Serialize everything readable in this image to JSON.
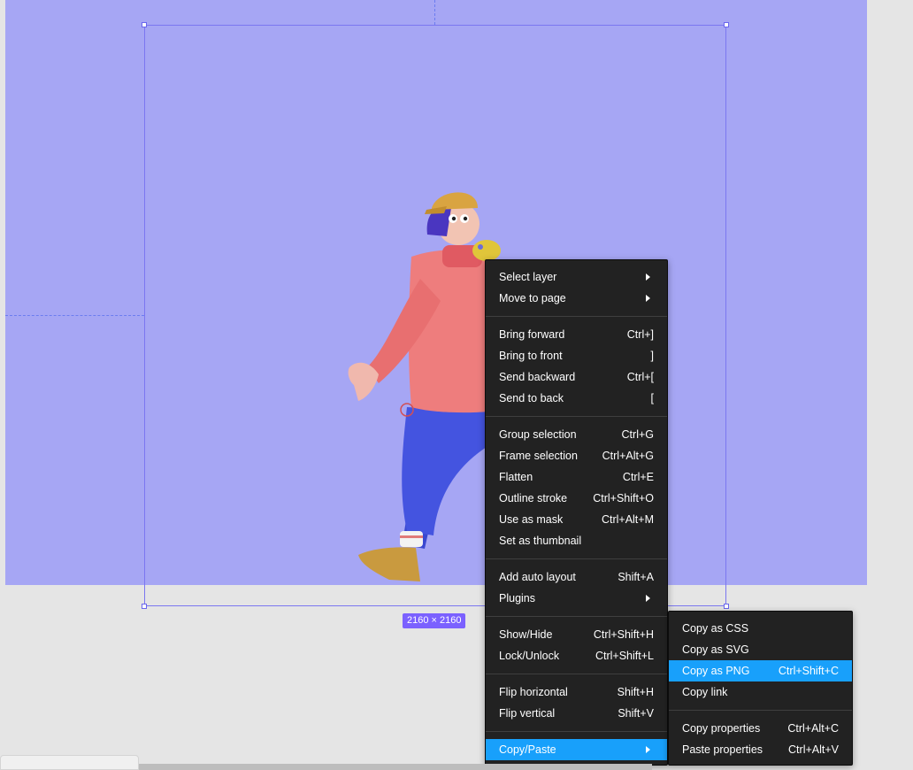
{
  "canvas": {
    "frame_color": "#a6a6f4",
    "selection_color": "#7b77f0",
    "size_label": "2160 × 2160"
  },
  "illustration": {
    "subject": "3d-character-walking-with-bird-icon",
    "colors": {
      "sweater": "#ee7d7d",
      "pants": "#4454e0",
      "cap": "#d9a441",
      "shoe": "#c99a3f",
      "hair": "#4a36c0",
      "bird": "#e0c53a"
    }
  },
  "context_menu": {
    "groups": [
      [
        {
          "label": "Select layer",
          "shortcut": "",
          "submenu": true
        },
        {
          "label": "Move to page",
          "shortcut": "",
          "submenu": true
        }
      ],
      [
        {
          "label": "Bring forward",
          "shortcut": "Ctrl+]"
        },
        {
          "label": "Bring to front",
          "shortcut": "]"
        },
        {
          "label": "Send backward",
          "shortcut": "Ctrl+["
        },
        {
          "label": "Send to back",
          "shortcut": "["
        }
      ],
      [
        {
          "label": "Group selection",
          "shortcut": "Ctrl+G"
        },
        {
          "label": "Frame selection",
          "shortcut": "Ctrl+Alt+G"
        },
        {
          "label": "Flatten",
          "shortcut": "Ctrl+E"
        },
        {
          "label": "Outline stroke",
          "shortcut": "Ctrl+Shift+O"
        },
        {
          "label": "Use as mask",
          "shortcut": "Ctrl+Alt+M"
        },
        {
          "label": "Set as thumbnail",
          "shortcut": ""
        }
      ],
      [
        {
          "label": "Add auto layout",
          "shortcut": "Shift+A"
        },
        {
          "label": "Plugins",
          "shortcut": "",
          "submenu": true
        }
      ],
      [
        {
          "label": "Show/Hide",
          "shortcut": "Ctrl+Shift+H"
        },
        {
          "label": "Lock/Unlock",
          "shortcut": "Ctrl+Shift+L"
        }
      ],
      [
        {
          "label": "Flip horizontal",
          "shortcut": "Shift+H"
        },
        {
          "label": "Flip vertical",
          "shortcut": "Shift+V"
        }
      ],
      [
        {
          "label": "Copy/Paste",
          "shortcut": "",
          "submenu": true,
          "active": true
        }
      ]
    ],
    "active_color": "#18a0fb"
  },
  "submenu": {
    "groups": [
      [
        {
          "label": "Copy as CSS",
          "shortcut": ""
        },
        {
          "label": "Copy as SVG",
          "shortcut": ""
        },
        {
          "label": "Copy as PNG",
          "shortcut": "Ctrl+Shift+C",
          "active": true
        },
        {
          "label": "Copy link",
          "shortcut": ""
        }
      ],
      [
        {
          "label": "Copy properties",
          "shortcut": "Ctrl+Alt+C"
        },
        {
          "label": "Paste properties",
          "shortcut": "Ctrl+Alt+V"
        }
      ]
    ]
  }
}
